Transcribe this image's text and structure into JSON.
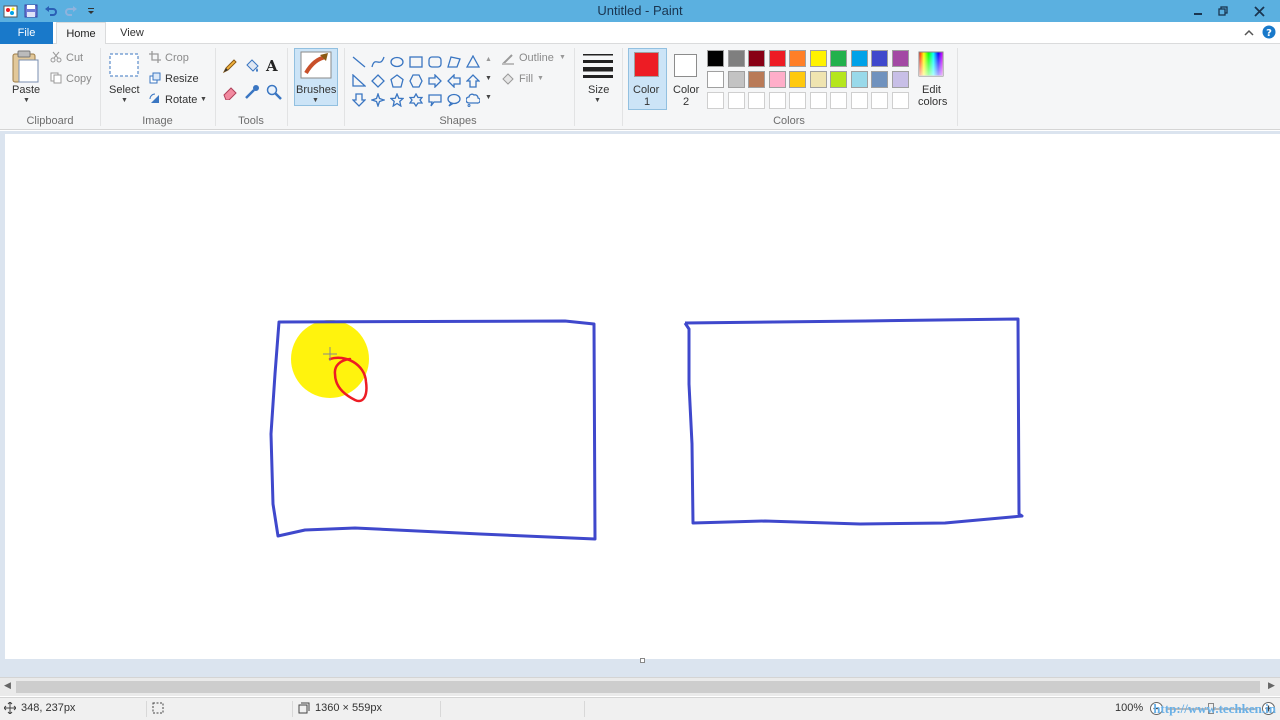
{
  "window": {
    "title": "Untitled - Paint",
    "accent": "#5bb0e0"
  },
  "tabs": {
    "file": "File",
    "home": "Home",
    "view": "View"
  },
  "ribbon": {
    "clipboard": {
      "label": "Clipboard",
      "paste": "Paste",
      "cut": "Cut",
      "copy": "Copy"
    },
    "image": {
      "label": "Image",
      "select": "Select",
      "crop": "Crop",
      "resize": "Resize",
      "rotate": "Rotate"
    },
    "tools": {
      "label": "Tools"
    },
    "brushes": {
      "label": "Brushes"
    },
    "shapes": {
      "label": "Shapes",
      "outline": "Outline",
      "fill": "Fill"
    },
    "size": {
      "label": "Size"
    },
    "colors": {
      "label": "Colors",
      "color1_label": "Color",
      "color1_num": "1",
      "color2_label": "Color",
      "color2_num": "2",
      "edit_label": "Edit",
      "edit_label2": "colors",
      "color1": "#ed1c24",
      "color2": "#ffffff",
      "palette_row1": [
        "#000000",
        "#7f7f7f",
        "#880015",
        "#ed1c24",
        "#ff7f27",
        "#fff200",
        "#22b14c",
        "#00a2e8",
        "#3f48cc",
        "#a349a4"
      ],
      "palette_row2": [
        "#ffffff",
        "#c3c3c3",
        "#b97a57",
        "#ffaec9",
        "#ffc90e",
        "#efe4b0",
        "#b5e61d",
        "#99d9ea",
        "#7092be",
        "#c8bfe7"
      ]
    }
  },
  "canvas": {
    "stroke_color": "#3f48cc",
    "scribble_color": "#ed1c24",
    "cursor_highlight": "#fff200"
  },
  "status": {
    "cursor_pos": "348, 237px",
    "canvas_size": "1360 × 559px",
    "zoom": "100%",
    "watermark": "http://www.techken.in"
  }
}
